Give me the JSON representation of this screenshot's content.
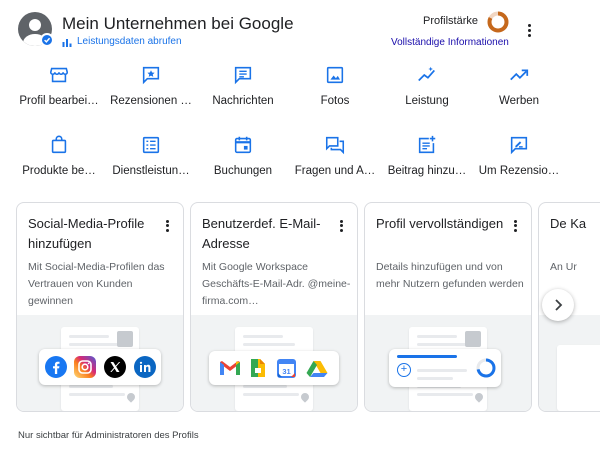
{
  "header": {
    "title": "Mein Unternehmen bei Google",
    "performance_link": "Leistungsdaten abrufen",
    "profile_strength_label": "Profilstärke",
    "full_info_link": "Vollständige Informationen"
  },
  "actions": [
    {
      "label": "Profil bearbei…",
      "icon": "storefront-icon"
    },
    {
      "label": "Rezensionen …",
      "icon": "review-star-icon"
    },
    {
      "label": "Nachrichten",
      "icon": "message-icon"
    },
    {
      "label": "Fotos",
      "icon": "photo-icon"
    },
    {
      "label": "Leistung",
      "icon": "performance-sparkle-icon"
    },
    {
      "label": "Werben",
      "icon": "trending-up-icon"
    },
    {
      "label": "Produkte be…",
      "icon": "shopping-bag-icon"
    },
    {
      "label": "Dienstleistun…",
      "icon": "list-icon"
    },
    {
      "label": "Buchungen",
      "icon": "calendar-icon"
    },
    {
      "label": "Fragen und A…",
      "icon": "forum-icon"
    },
    {
      "label": "Beitrag hinzu…",
      "icon": "post-add-icon"
    },
    {
      "label": "Um Rezensio…",
      "icon": "rate-review-icon"
    }
  ],
  "cards": [
    {
      "title": "Social-Media-Profile hinzufügen",
      "description": "Mit Social-Media-Profilen das Vertrauen von Kunden gewinnen"
    },
    {
      "title": "Benutzerdef. E-Mail-Adresse",
      "description": "Mit Google Workspace Geschäfts-E-Mail-Adr. @meine-firma.com…"
    },
    {
      "title": "Profil vervollständigen",
      "description": "Details hinzufügen und von mehr Nutzern gefunden werden"
    },
    {
      "title": "De Ka",
      "description": "An Ur"
    }
  ],
  "footer": {
    "note": "Nur sichtbar für Administratoren des Profils"
  },
  "colors": {
    "accent": "#1a73e8",
    "link_dark": "#1a0dab",
    "strength_ring": "#c5681c",
    "text": "#202124",
    "muted": "#5f6368"
  }
}
